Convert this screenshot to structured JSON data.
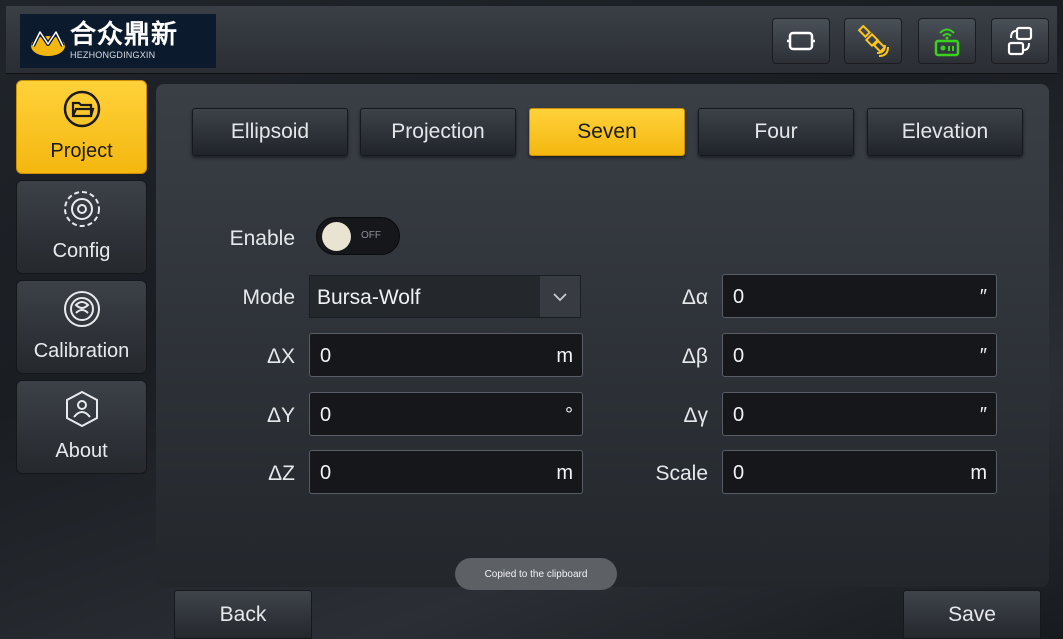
{
  "header": {
    "logo_cn": "合众鼎新",
    "logo_en": "HEZHONGDINGXIN",
    "icons": [
      "screen-icon",
      "satellite-icon",
      "radio-icon",
      "switch-icon"
    ]
  },
  "sidebar": {
    "items": [
      {
        "label": "Project",
        "icon": "folder-icon",
        "active": true
      },
      {
        "label": "Config",
        "icon": "settings-icon",
        "active": false
      },
      {
        "label": "Calibration",
        "icon": "calibration-icon",
        "active": false
      },
      {
        "label": "About",
        "icon": "about-icon",
        "active": false
      }
    ]
  },
  "tabs": [
    "Ellipsoid",
    "Projection",
    "Seven",
    "Four",
    "Elevation"
  ],
  "active_tab": "Seven",
  "form": {
    "enable_label": "Enable",
    "toggle_state": "OFF",
    "mode_label": "Mode",
    "mode_value": "Bursa-Wolf",
    "dx": {
      "label": "ΔX",
      "value": "0",
      "unit": "m"
    },
    "dy": {
      "label": "ΔY",
      "value": "0",
      "unit": "°"
    },
    "dz": {
      "label": "ΔZ",
      "value": "0",
      "unit": "m"
    },
    "da": {
      "label": "Δα",
      "value": "0",
      "unit": "″"
    },
    "db": {
      "label": "Δβ",
      "value": "0",
      "unit": "″"
    },
    "dg": {
      "label": "Δγ",
      "value": "0",
      "unit": "″"
    },
    "scale": {
      "label": "Scale",
      "value": "0",
      "unit": "m"
    }
  },
  "toast": "Copied to the clipboard",
  "footer": {
    "back_label": "Back",
    "save_label": "Save"
  },
  "colors": {
    "accent": "#f9c41e",
    "panel": "#2f3339",
    "field": "#15171a"
  }
}
